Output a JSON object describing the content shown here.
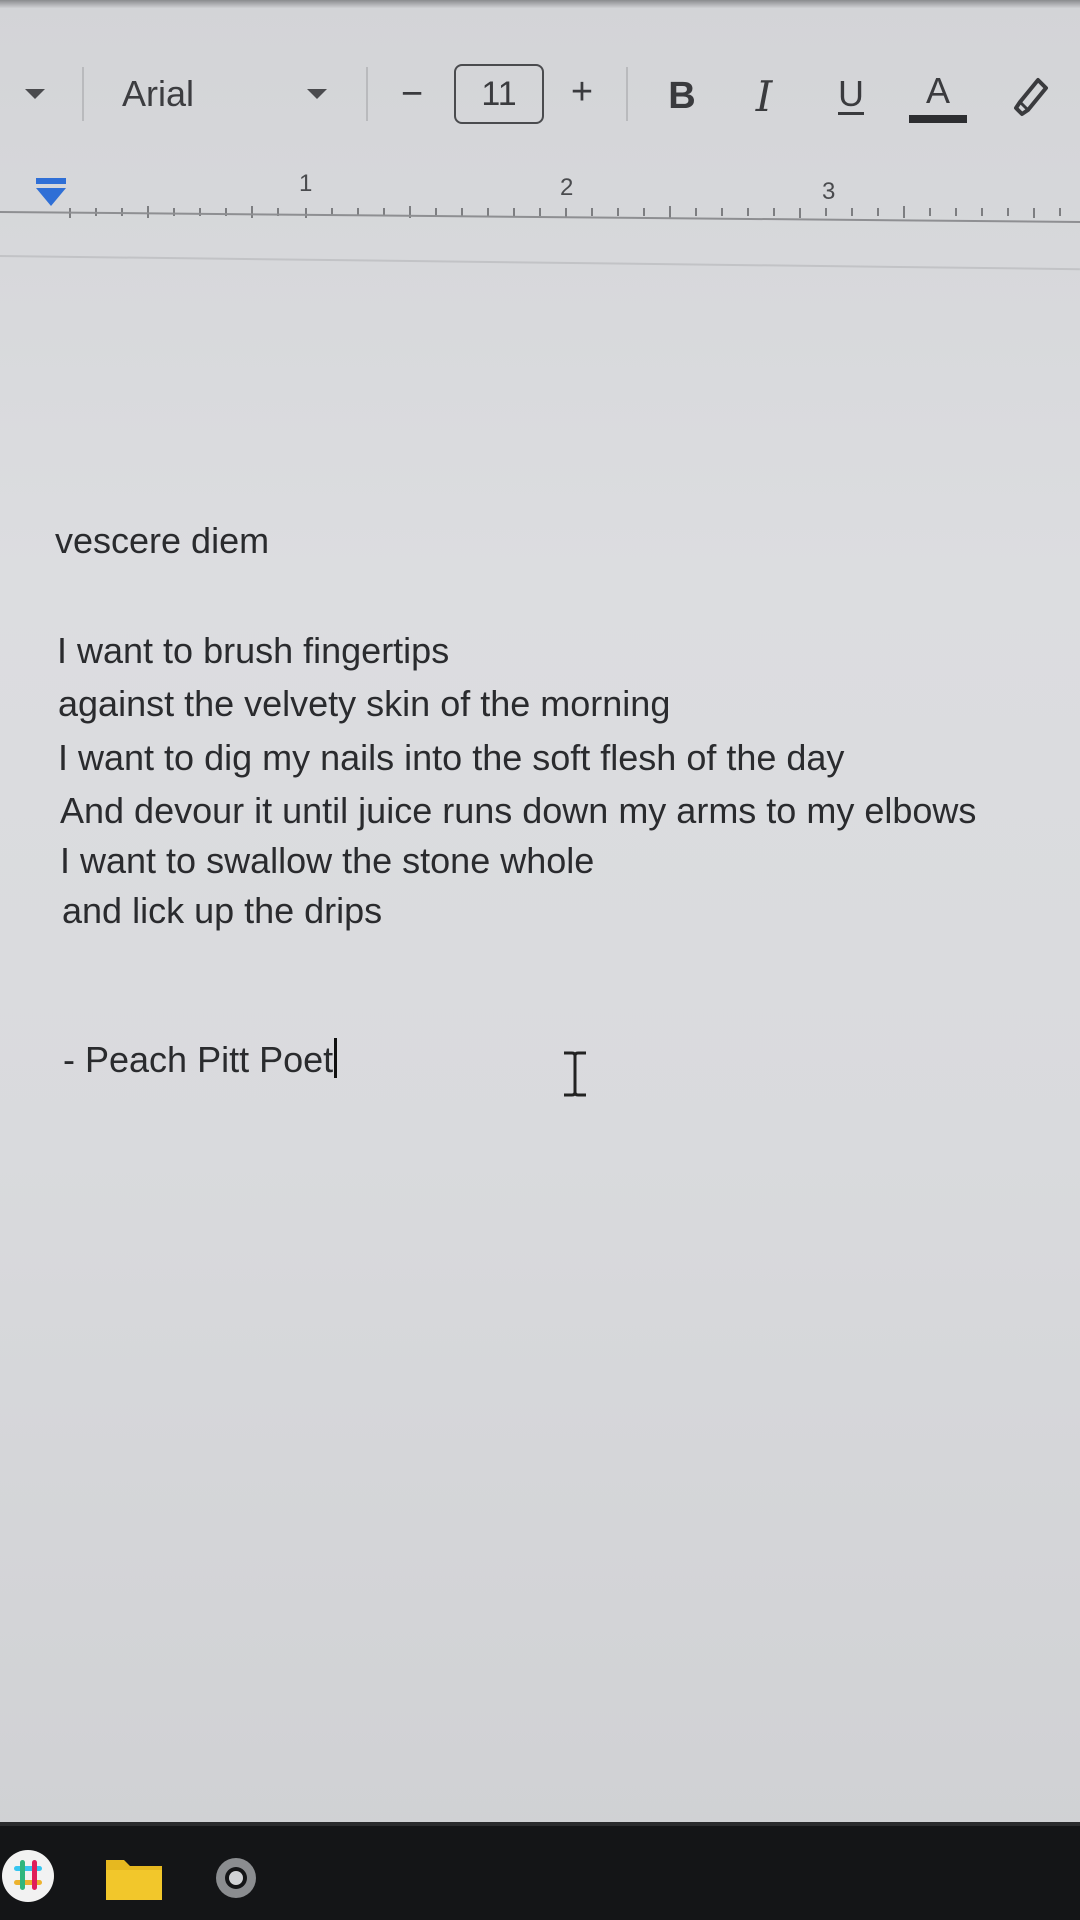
{
  "toolbar": {
    "font_name": "Arial",
    "font_size": "11",
    "decrease_label": "−",
    "increase_label": "+",
    "bold_label": "B",
    "italic_label": "I",
    "underline_label": "U",
    "text_color_label": "A"
  },
  "ruler": {
    "numbers": [
      "1",
      "2",
      "3"
    ]
  },
  "document": {
    "title": "vescere diem",
    "lines": [
      "I want to brush fingertips",
      "against the velvety skin of the morning",
      "I want to dig my nails into the soft flesh of the day",
      "And devour it until juice runs down my arms to my elbows",
      "I want to swallow the stone whole",
      "and lick up the drips"
    ],
    "signature": "- Peach Pitt Poet"
  },
  "taskbar": {
    "icons": [
      "slack-icon",
      "files-icon",
      "settings-icon"
    ]
  }
}
